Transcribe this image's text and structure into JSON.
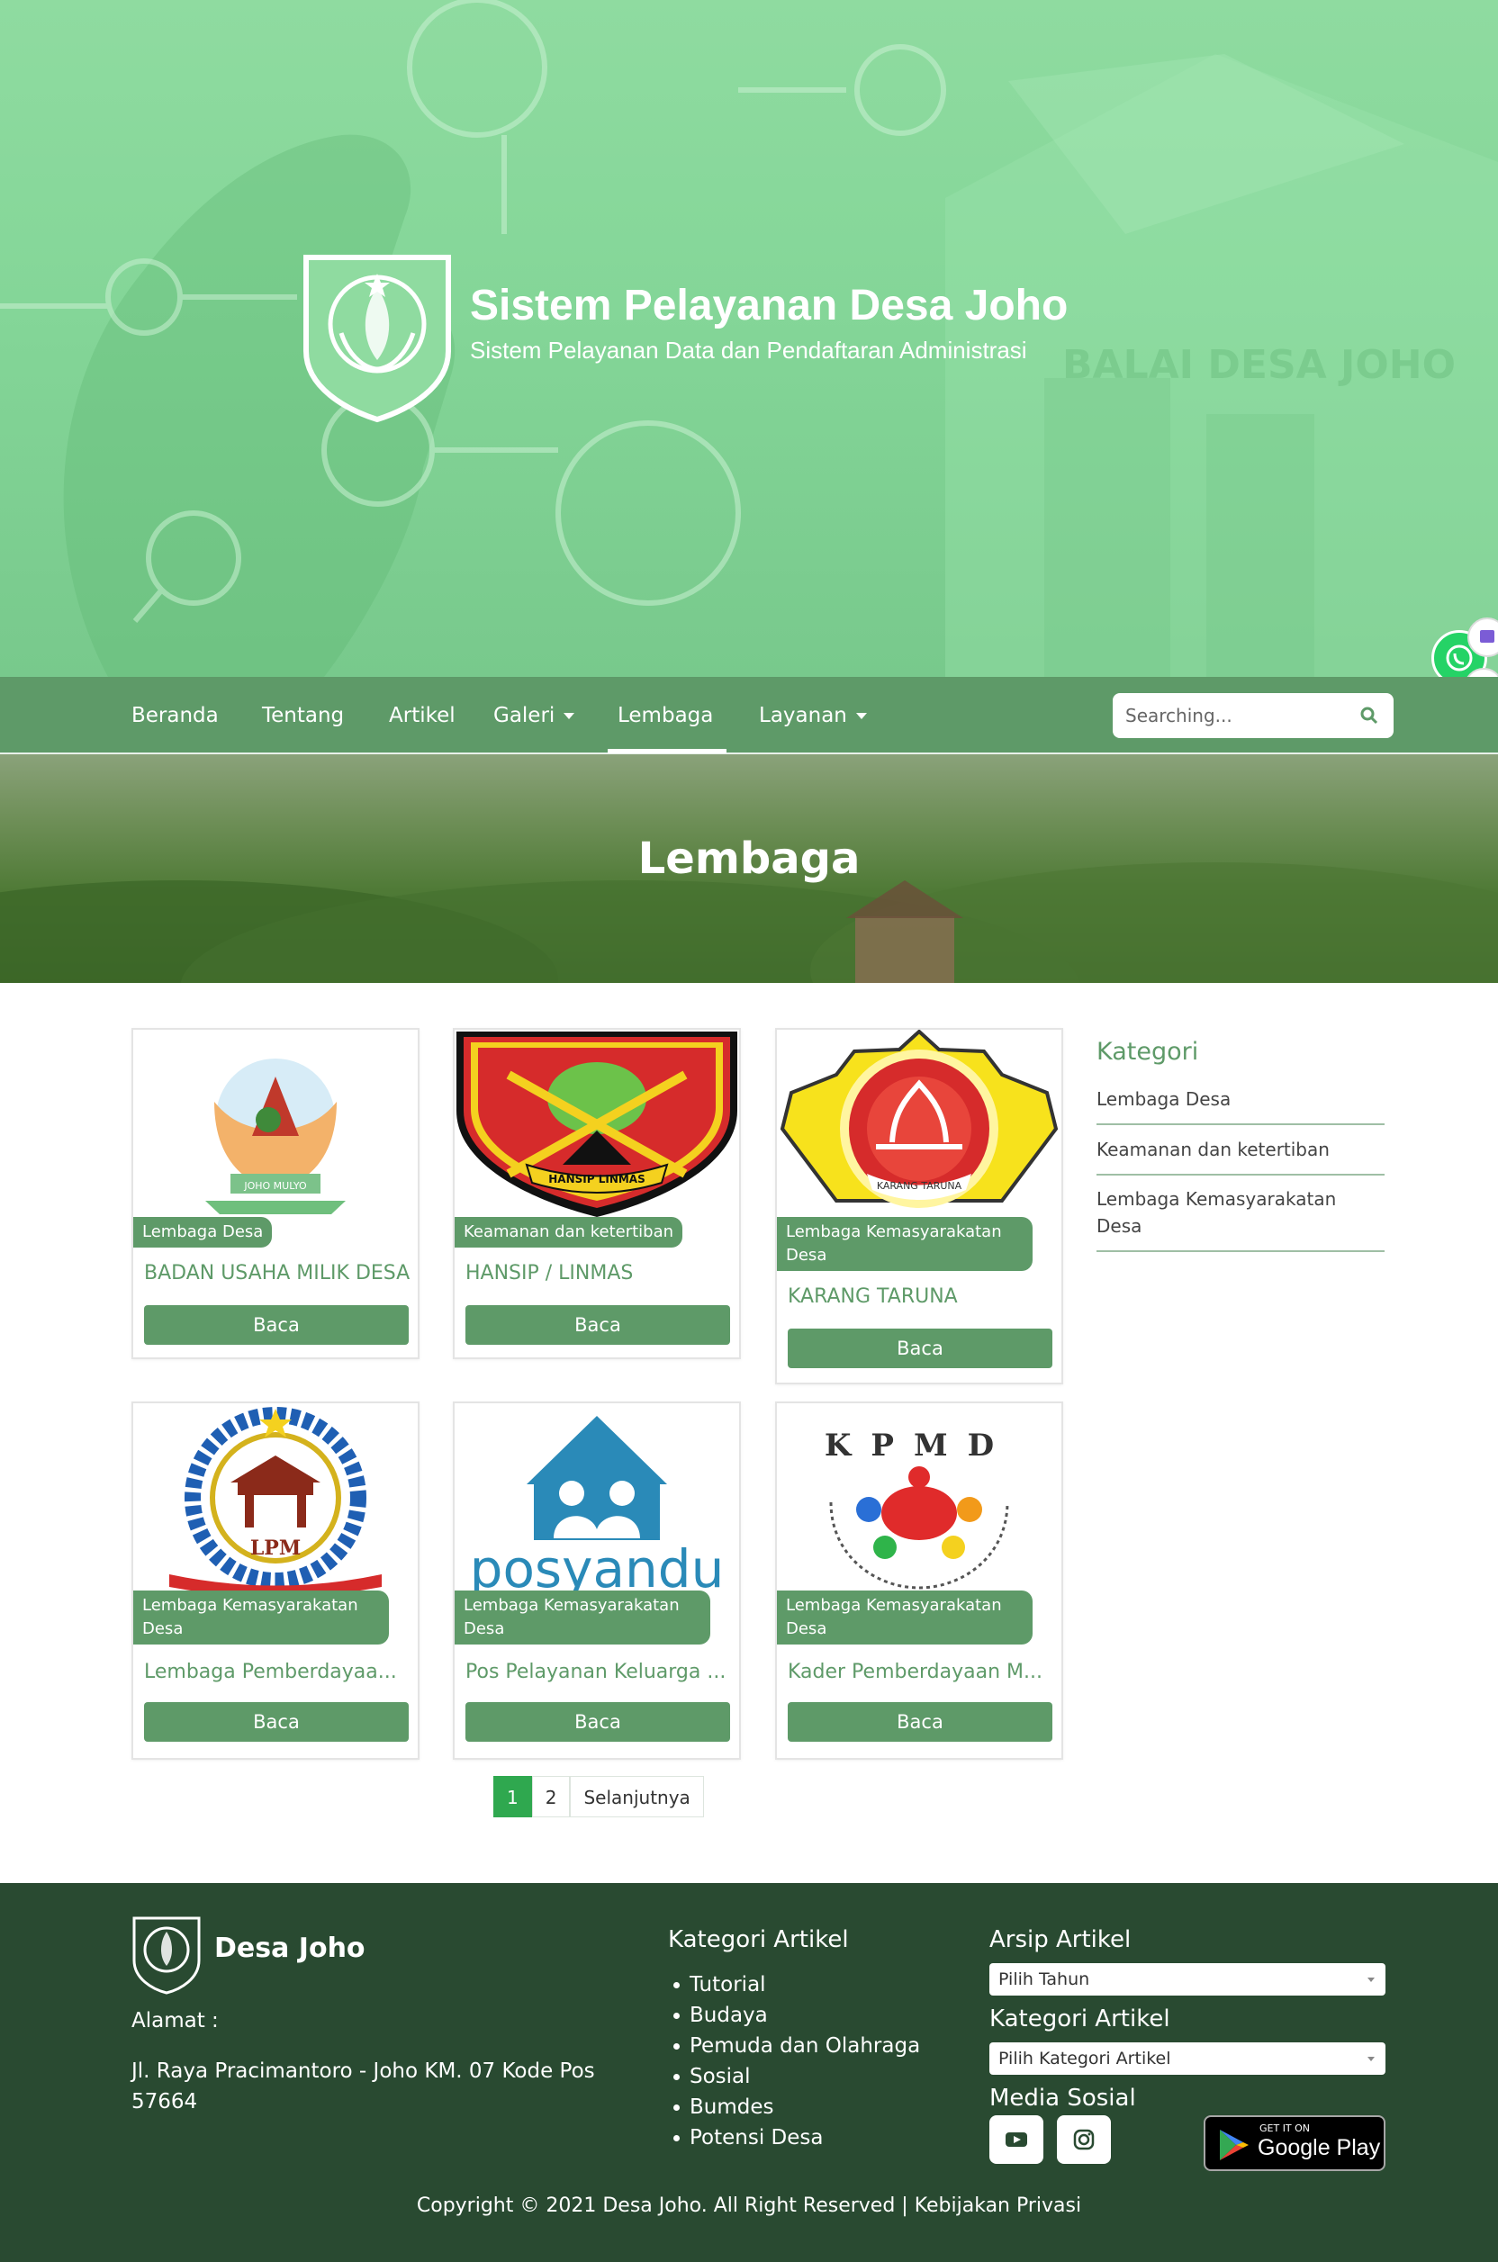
{
  "hero": {
    "title": "Sistem Pelayanan Desa Joho",
    "subtitle": "Sistem Pelayanan Data dan Pendaftaran Administrasi",
    "watermark": "BALAI DESA JOHO"
  },
  "nav": {
    "items": [
      {
        "label": "Beranda",
        "dropdown": false
      },
      {
        "label": "Tentang",
        "dropdown": false
      },
      {
        "label": "Artikel",
        "dropdown": false
      },
      {
        "label": "Galeri",
        "dropdown": true
      },
      {
        "label": "Lembaga",
        "dropdown": false,
        "active": true
      },
      {
        "label": "Layanan",
        "dropdown": true
      }
    ],
    "search_placeholder": "Searching..."
  },
  "banner": {
    "title": "Lembaga"
  },
  "cards": [
    {
      "badge": "Lembaga Desa",
      "title": "BADAN USAHA MILIK DESA...",
      "button": "Baca",
      "logo_text": "JOHO MULYO"
    },
    {
      "badge": "Keamanan dan ketertiban",
      "title": "HANSIP / LINMAS",
      "button": "Baca",
      "logo_text": "HANSIP LINMAS"
    },
    {
      "badge": "Lembaga Kemasyarakatan Desa",
      "title": "KARANG TARUNA",
      "button": "Baca",
      "logo_text": "KARANG TARUNA"
    },
    {
      "badge": "Lembaga Kemasyarakatan Desa",
      "title": "Lembaga Pemberdayaa...",
      "button": "Baca",
      "logo_text": "LPM"
    },
    {
      "badge": "Lembaga Kemasyarakatan Desa",
      "title": "Pos Pelayanan Keluarga ...",
      "button": "Baca",
      "logo_text": "posyandu"
    },
    {
      "badge": "Lembaga Kemasyarakatan Desa",
      "title": "Kader Pemberdayaan M...",
      "button": "Baca",
      "logo_text": "KPMD"
    }
  ],
  "sidebar": {
    "title": "Kategori",
    "items": [
      "Lembaga Desa",
      "Keamanan dan ketertiban",
      "Lembaga Kemasyarakatan Desa"
    ]
  },
  "pagination": {
    "pages": [
      "1",
      "2"
    ],
    "next": "Selanjutnya",
    "current": "1"
  },
  "footer": {
    "brand": "Desa Joho",
    "address_label": "Alamat :",
    "address": "Jl. Raya Pracimantoro - Joho KM. 07 Kode Pos 57664",
    "kategori_heading": "Kategori Artikel",
    "kategori_items": [
      "Tutorial",
      "Budaya",
      "Pemuda dan Olahraga",
      "Sosial",
      "Bumdes",
      "Potensi Desa"
    ],
    "arsip_heading": "Arsip Artikel",
    "arsip_select": "Pilih Tahun",
    "kategori2_heading": "Kategori Artikel",
    "kategori2_select": "Pilih Kategori Artikel",
    "media_heading": "Media Sosial",
    "gplay_small": "GET IT ON",
    "gplay_big": "Google Play",
    "copyright": "Copyright © 2021 Desa Joho. All Right Reserved | Kebijakan Privasi"
  },
  "colors": {
    "primary": "#5e9a68",
    "footer_bg": "#294a31",
    "hero_green": "#84d698",
    "page_active": "#2fa84f"
  }
}
